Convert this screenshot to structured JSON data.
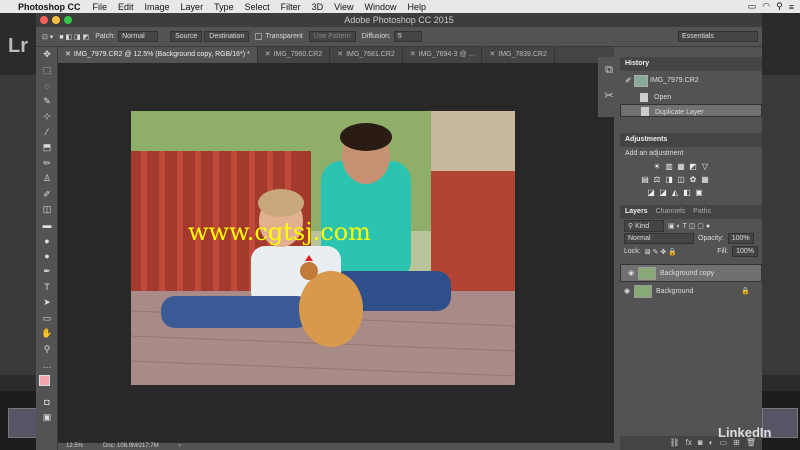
{
  "menubar": {
    "app": "Photoshop CC",
    "items": [
      "File",
      "Edit",
      "Image",
      "Layer",
      "Type",
      "Select",
      "Filter",
      "3D",
      "View",
      "Window",
      "Help"
    ]
  },
  "lightroom": {
    "logo": "Lr"
  },
  "window": {
    "title": "Adobe Photoshop CC 2015"
  },
  "options": {
    "patch_label": "Patch:",
    "patch_mode": "Normal",
    "source": "Source",
    "destination": "Destination",
    "transparent": "Transparent",
    "use_pattern": "Use Pattern",
    "diffusion_label": "Diffusion:",
    "diffusion_value": "5",
    "workspace": "Essentials"
  },
  "tabs": [
    {
      "label": "IMG_7979.CR2 @ 12.5% (Background copy, RGB/16*) *",
      "active": true
    },
    {
      "label": "IMG_7960.CR2",
      "active": false
    },
    {
      "label": "IMG_7681.CR2",
      "active": false
    },
    {
      "label": "IMG_7694-3 @ ...",
      "active": false
    },
    {
      "label": "IMG_7839.CR2",
      "active": false
    }
  ],
  "watermark": "www.cgtsj.com",
  "status": {
    "zoom": "12.5%",
    "doc": "Doc: 108.9M/217.7M"
  },
  "history": {
    "title": "History",
    "snapshot": "IMG_7979.CR2",
    "steps": [
      {
        "label": "Open",
        "selected": false
      },
      {
        "label": "Duplicate Layer",
        "selected": true
      }
    ]
  },
  "adjustments": {
    "title": "Adjustments",
    "subtitle": "Add an adjustment",
    "row1": [
      "☀",
      "▥",
      "▦",
      "◩",
      "▽"
    ],
    "row2": [
      "▤",
      "⚖",
      "◨",
      "◫",
      "✿",
      "▦"
    ],
    "row3": [
      "◪",
      "◪",
      "◭",
      "◧",
      "▣"
    ]
  },
  "layers": {
    "tabs": [
      "Layers",
      "Channels",
      "Paths"
    ],
    "kind": "Kind",
    "blend": "Normal",
    "opacity_label": "Opacity:",
    "opacity": "100%",
    "lock_label": "Lock:",
    "fill_label": "Fill:",
    "fill": "100%",
    "items": [
      {
        "name": "Background copy",
        "selected": true
      },
      {
        "name": "Background",
        "selected": false
      }
    ]
  },
  "brand": "LinkedIn"
}
